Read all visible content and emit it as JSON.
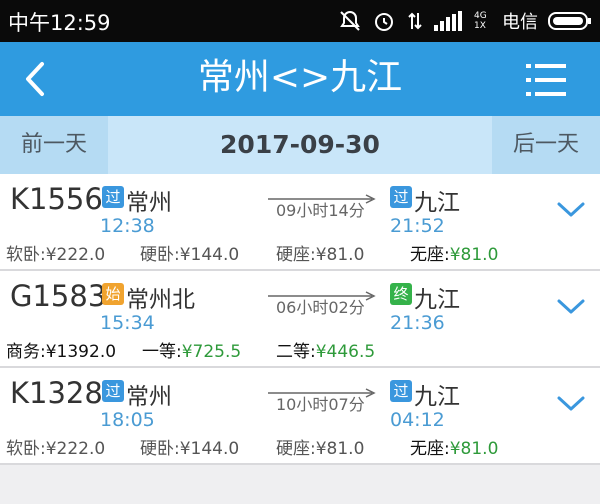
{
  "status_bar": {
    "time": "中午12:59",
    "carrier": "电信",
    "network": "4G 1X"
  },
  "header": {
    "title": "常州<>九江",
    "back_icon": "chevron-left-icon",
    "menu_icon": "list-menu-icon"
  },
  "date_bar": {
    "prev_label": "前一天",
    "date": "2017-09-30",
    "next_label": "后一天"
  },
  "trains": [
    {
      "number": "K1556",
      "from_badge": "过",
      "from": "常州",
      "depart": "12:38",
      "duration": "09小时14分",
      "to_badge": "过",
      "to": "九江",
      "arrive": "21:52",
      "seats": [
        {
          "name": "软卧:",
          "price": "¥222.0"
        },
        {
          "name": "硬卧:",
          "price": "¥144.0"
        },
        {
          "name": "硬座:",
          "price": "¥81.0"
        },
        {
          "name": "无座:",
          "price": "¥81.0"
        }
      ]
    },
    {
      "number": "G1583",
      "from_badge": "始",
      "from": "常州北",
      "depart": "15:34",
      "duration": "06小时02分",
      "to_badge": "终",
      "to": "九江",
      "arrive": "21:36",
      "seats": [
        {
          "name": "商务:",
          "price": "¥1392.0"
        },
        {
          "name": "一等:",
          "price": "¥725.5"
        },
        {
          "name": "二等:",
          "price": "¥446.5"
        }
      ]
    },
    {
      "number": "K1328",
      "from_badge": "过",
      "from": "常州",
      "depart": "18:05",
      "duration": "10小时07分",
      "to_badge": "过",
      "to": "九江",
      "arrive": "04:12",
      "seats": [
        {
          "name": "软卧:",
          "price": "¥222.0"
        },
        {
          "name": "硬卧:",
          "price": "¥144.0"
        },
        {
          "name": "硬座:",
          "price": "¥81.0"
        },
        {
          "name": "无座:",
          "price": "¥81.0"
        }
      ]
    }
  ],
  "colors": {
    "header_bg": "#2f9be0",
    "date_bar_bg": "#c9e6f9",
    "time_blue": "#4a9bd3",
    "available_green": "#2e9a3a"
  }
}
